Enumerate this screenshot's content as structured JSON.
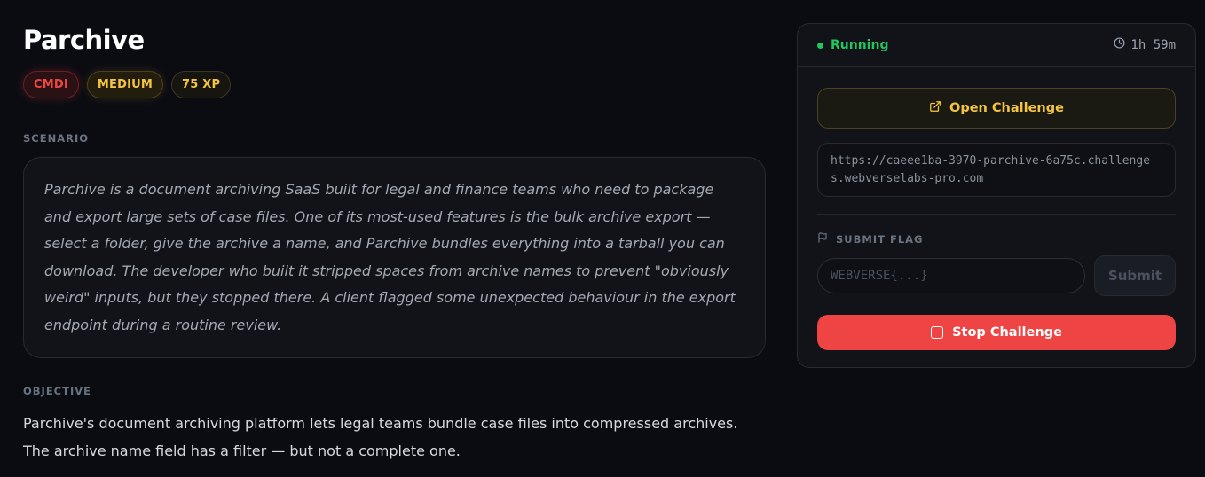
{
  "challenge": {
    "title": "Parchive",
    "badges": {
      "category": "CMDI",
      "difficulty": "MEDIUM",
      "xp": "75 XP"
    }
  },
  "scenario": {
    "label": "SCENARIO",
    "text": "Parchive is a document archiving SaaS built for legal and finance teams who need to package and export large sets of case files. One of its most-used features is the bulk archive export — select a folder, give the archive a name, and Parchive bundles everything into a tarball you can download. The developer who built it stripped spaces from archive names to prevent \"obviously weird\" inputs, but they stopped there. A client flagged some unexpected behaviour in the export endpoint during a routine review."
  },
  "objective": {
    "label": "OBJECTIVE",
    "text": "Parchive's document archiving platform lets legal teams bundle case files into compressed archives. The archive name field has a filter — but not a complete one."
  },
  "panel": {
    "status": "Running",
    "timer": "1h 59m",
    "open_challenge_label": "Open Challenge",
    "url": "https://caeee1ba-3970-parchive-6a75c.challenges.webverselabs-pro.com",
    "submit_flag_label": "SUBMIT FLAG",
    "flag_placeholder": "WEBVERSE{...}",
    "submit_label": "Submit",
    "stop_label": "Stop Challenge"
  },
  "colors": {
    "background": "#0b0c12",
    "accent_gold": "#f5c542",
    "danger_red": "#ef4444",
    "running_green": "#22c55e"
  },
  "icons": [
    "clock-icon",
    "external-link-icon",
    "flag-icon",
    "stop-square-icon"
  ]
}
